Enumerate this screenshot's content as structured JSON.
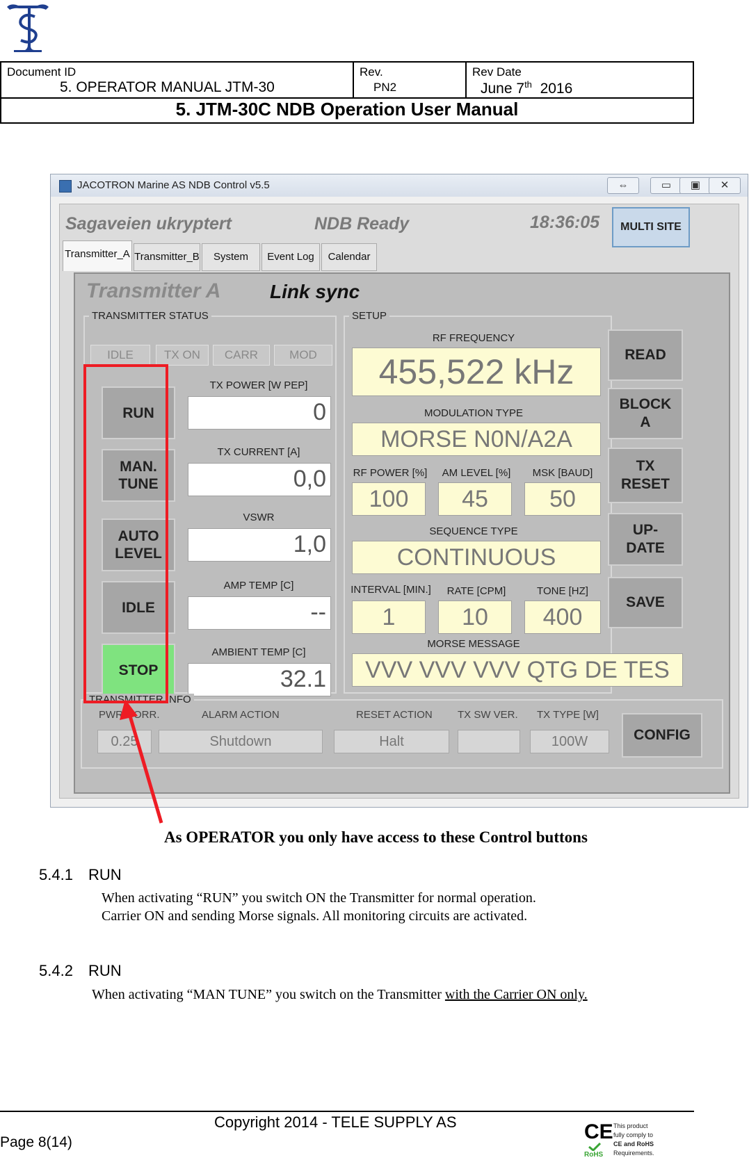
{
  "header": {
    "doc_id_label": "Document ID",
    "doc_id_value": "5. OPERATOR MANUAL JTM-30",
    "rev_label": "Rev.",
    "rev_value": "PN2",
    "rev_date_label": "Rev Date",
    "rev_date_month": "June 7",
    "rev_date_sup": "th",
    "rev_date_year": "2016",
    "title": "5. JTM-30C NDB Operation User Manual"
  },
  "app": {
    "window_title": "JACOTRON Marine AS NDB  Control v5.5",
    "site_name": "Sagaveien ukryptert",
    "status": "NDB Ready",
    "clock": "18:36:05",
    "multi_site_label": "MULTI SITE",
    "window_buttons": [
      "⇔",
      "▭",
      "▣",
      "✕"
    ],
    "tabs": [
      "Transmitter_A",
      "Transmitter_B",
      "System",
      "Event Log",
      "Calendar"
    ],
    "panel_title": "Transmitter A",
    "panel_sync": "Link sync",
    "tx_status": {
      "group_label": "TRANSMITTER STATUS",
      "indicators": [
        "IDLE",
        "TX ON",
        "CARR",
        "MOD"
      ]
    },
    "control_buttons": [
      {
        "label": "RUN"
      },
      {
        "label": "MAN.\nTUNE"
      },
      {
        "label": "AUTO\nLEVEL"
      },
      {
        "label": "IDLE"
      },
      {
        "label": "STOP"
      }
    ],
    "readings": [
      {
        "label": "TX POWER [W PEP]",
        "value": "0"
      },
      {
        "label": "TX CURRENT [A]",
        "value": "0,0"
      },
      {
        "label": "VSWR",
        "value": "1,0"
      },
      {
        "label": "AMP TEMP  [C]",
        "value": "--"
      },
      {
        "label": "AMBIENT TEMP  [C]",
        "value": "32.1"
      }
    ],
    "setup": {
      "group_label": "SETUP",
      "rf_frequency_label": "RF FREQUENCY",
      "rf_frequency": "455,522 kHz",
      "modulation_type_label": "MODULATION TYPE",
      "modulation_type": "MORSE N0N/A2A",
      "rf_power_label": "RF POWER [%]",
      "rf_power": "100",
      "am_level_label": "AM LEVEL [%]",
      "am_level": "45",
      "msk_label": "MSK [BAUD]",
      "msk": "50",
      "sequence_type_label": "SEQUENCE TYPE",
      "sequence_type": "CONTINUOUS",
      "interval_label": "INTERVAL [MIN.]",
      "interval": "1",
      "rate_label": "RATE [CPM]",
      "rate": "10",
      "tone_label": "TONE [HZ]",
      "tone": "400",
      "morse_message_label": "MORSE MESSAGE",
      "morse_message": "VVV VVV VVV QTG DE TES"
    },
    "setup_buttons": [
      "READ",
      "BLOCK\nA",
      "TX\nRESET",
      "UP-\nDATE",
      "SAVE"
    ],
    "tx_info": {
      "group_label": "TRANSMITTER INFO",
      "pwr_corr_label": "PWR CORR.",
      "pwr_corr": "0.25",
      "alarm_action_label": "ALARM ACTION",
      "alarm_action": "Shutdown",
      "reset_action_label": "RESET ACTION",
      "reset_action": "Halt",
      "tx_sw_ver_label": "TX SW VER.",
      "tx_sw_ver": "",
      "tx_type_label": "TX TYPE [W]",
      "tx_type": "100W",
      "config_label": "CONFIG"
    }
  },
  "annotation": {
    "caption": "As OPERATOR you only have access to these Control buttons",
    "highlight_color": "#ee1c24"
  },
  "sections": [
    {
      "number": "5.4.1",
      "title": "RUN",
      "lines": [
        "When activating “RUN” you switch ON the Transmitter for normal operation.",
        "Carrier ON and sending Morse signals. All monitoring circuits are activated."
      ]
    },
    {
      "number": "5.4.2",
      "title": "RUN",
      "line_prefix": "When activating “MAN TUNE” you switch on the Transmitter ",
      "line_underlined": "with the Carrier ON only."
    }
  ],
  "footer": {
    "copyright": "Copyright 2014  -  TELE SUPPLY AS",
    "page": "Page 8(14)",
    "ce_mark": "CE",
    "rohs_label": "RoHS",
    "compliance_lines": [
      "This product",
      "fully comply to",
      "CE and RoHS",
      "Requirements."
    ]
  }
}
